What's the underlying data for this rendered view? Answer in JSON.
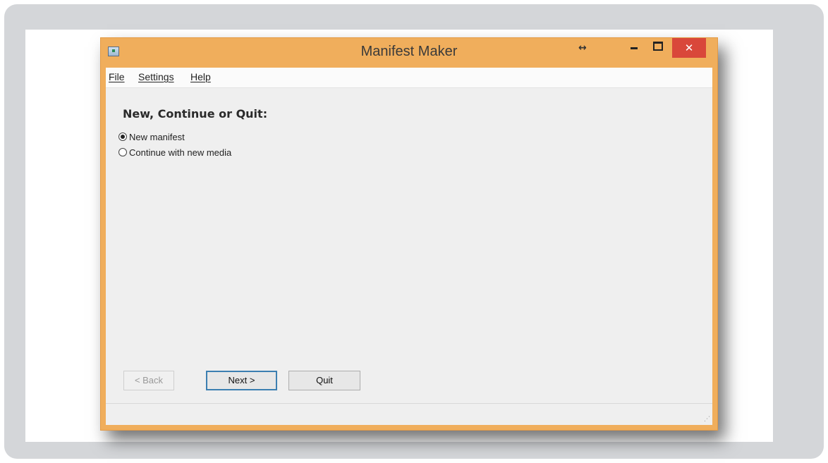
{
  "window": {
    "title": "Manifest Maker",
    "accent_color": "#f0ae5c",
    "close_color": "#d9473a",
    "resize_glyph": "↔",
    "minimize_glyph": "minimize-icon",
    "maximize_glyph": "maximize-icon",
    "close_glyph": "✕"
  },
  "menu": {
    "items": [
      {
        "label": "File"
      },
      {
        "label": "Settings"
      },
      {
        "label": "Help"
      }
    ]
  },
  "main": {
    "heading": "New, Continue or Quit:",
    "options": [
      {
        "label": "New manifest",
        "selected": true
      },
      {
        "label": "Continue with new media",
        "selected": false
      }
    ]
  },
  "buttons": {
    "back": "< Back",
    "next": "Next >",
    "quit": "Quit"
  }
}
